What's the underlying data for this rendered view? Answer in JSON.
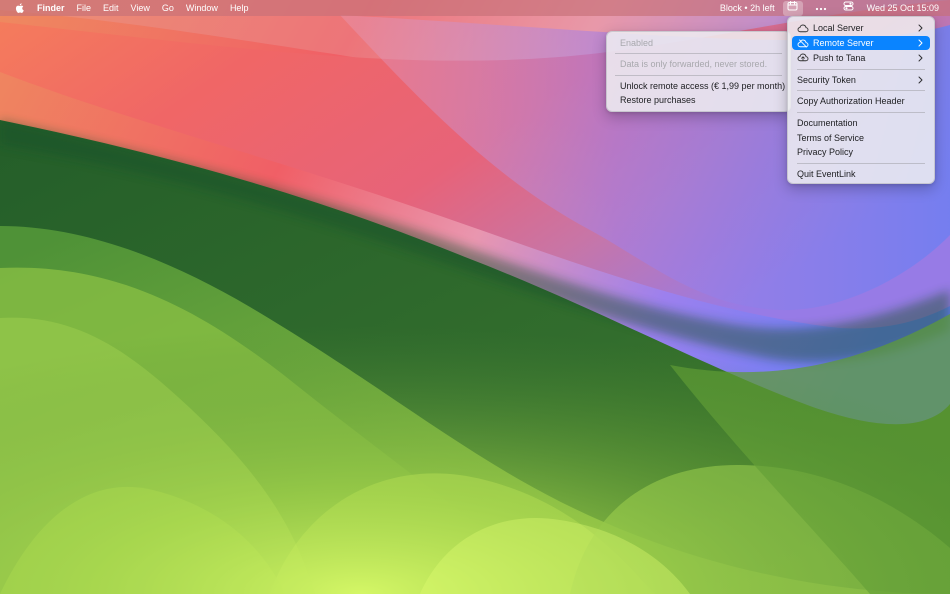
{
  "menubar": {
    "apple_icon": "apple-logo",
    "app_name": "Finder",
    "menus": [
      "File",
      "Edit",
      "View",
      "Go",
      "Window",
      "Help"
    ],
    "status_text": "Block • 2h left",
    "status_icons": [
      "calendar-icon",
      "ellipsis-icon",
      "control-center-icon"
    ],
    "datetime": "Wed 25 Oct  15:09"
  },
  "main_menu": {
    "items": [
      {
        "label": "Local Server",
        "icon": "cloud-icon",
        "has_submenu": true,
        "selected": false
      },
      {
        "label": "Remote Server",
        "icon": "cloud-off-icon",
        "has_submenu": true,
        "selected": true
      },
      {
        "label": "Push to Tana",
        "icon": "cloud-upload-icon",
        "has_submenu": true,
        "selected": false
      },
      {
        "label": "Security Token",
        "has_submenu": true,
        "selected": false
      },
      {
        "label": "Copy Authorization Header",
        "selected": false
      },
      {
        "label": "Documentation",
        "selected": false
      },
      {
        "label": "Terms of Service",
        "selected": false
      },
      {
        "label": "Privacy Policy",
        "selected": false
      },
      {
        "label": "Quit EventLink",
        "selected": false
      }
    ]
  },
  "remote_server_submenu": {
    "items": [
      {
        "label": "Enabled",
        "disabled": true
      },
      {
        "label": "Data is only forwarded, never stored.",
        "disabled": true
      },
      {
        "label": "Unlock remote access (€ 1,99 per month)",
        "disabled": false
      },
      {
        "label": "Restore purchases",
        "disabled": false
      }
    ]
  },
  "colors": {
    "selection": "#0a84ff",
    "menu_background": "#efeff1",
    "disabled_text": "#a8a8ad",
    "menubar_text": "#ffffff"
  }
}
